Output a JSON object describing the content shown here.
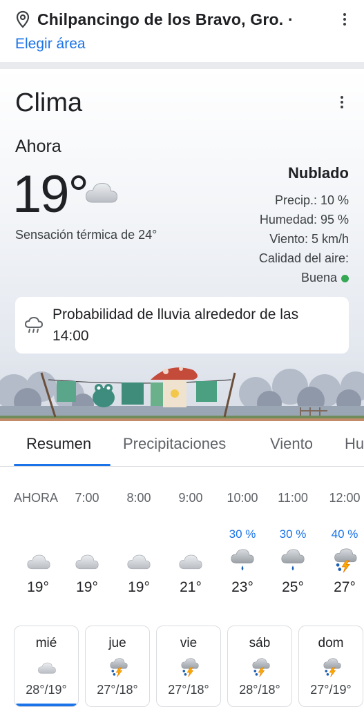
{
  "location": {
    "name": "Chilpancingo de los Bravo, Gro. ·",
    "choose_area": "Elegir área",
    "icons": [
      "location-pin-icon",
      "more-vert-icon"
    ]
  },
  "card": {
    "title": "Clima",
    "now_label": "Ahora",
    "temperature": "19°",
    "feels_like": "Sensación térmica de 24°",
    "condition": "Nublado",
    "precip": "Precip.: 10 %",
    "humidity": "Humedad: 95 %",
    "wind": "Viento: 5 km/h",
    "air_quality_label": "Calidad del aire:",
    "air_quality_value": "Buena",
    "rain_alert": "Probabilidad de lluvia alrededor de las 14:00",
    "colors": {
      "air_quality_dot": "#34a853",
      "accent": "#1a73e8"
    }
  },
  "tabs": [
    {
      "label": "Resumen",
      "active": true
    },
    {
      "label": "Precipitaciones",
      "active": false
    },
    {
      "label": "Viento",
      "active": false
    },
    {
      "label": "Hu",
      "active": false
    }
  ],
  "hourly": [
    {
      "time": "AHORA",
      "prob": "",
      "icon": "cloud-icon",
      "temp": "19°"
    },
    {
      "time": "7:00",
      "prob": "",
      "icon": "cloud-icon",
      "temp": "19°"
    },
    {
      "time": "8:00",
      "prob": "",
      "icon": "cloud-icon",
      "temp": "19°"
    },
    {
      "time": "9:00",
      "prob": "",
      "icon": "cloud-icon",
      "temp": "21°"
    },
    {
      "time": "10:00",
      "prob": "30 %",
      "icon": "rain-cloud-icon",
      "temp": "23°"
    },
    {
      "time": "11:00",
      "prob": "30 %",
      "icon": "rain-cloud-icon",
      "temp": "25°"
    },
    {
      "time": "12:00",
      "prob": "40 %",
      "icon": "thunderstorm-icon",
      "temp": "27°"
    }
  ],
  "daily": [
    {
      "day": "mié",
      "range": "28°/19°",
      "icon": "cloud-icon",
      "selected": true
    },
    {
      "day": "jue",
      "range": "27°/18°",
      "icon": "thunderstorm-icon",
      "selected": false
    },
    {
      "day": "vie",
      "range": "27°/18°",
      "icon": "thunderstorm-icon",
      "selected": false
    },
    {
      "day": "sáb",
      "range": "28°/18°",
      "icon": "thunderstorm-icon",
      "selected": false
    },
    {
      "day": "dom",
      "range": "27°/19°",
      "icon": "thunderstorm-icon",
      "selected": false
    }
  ]
}
